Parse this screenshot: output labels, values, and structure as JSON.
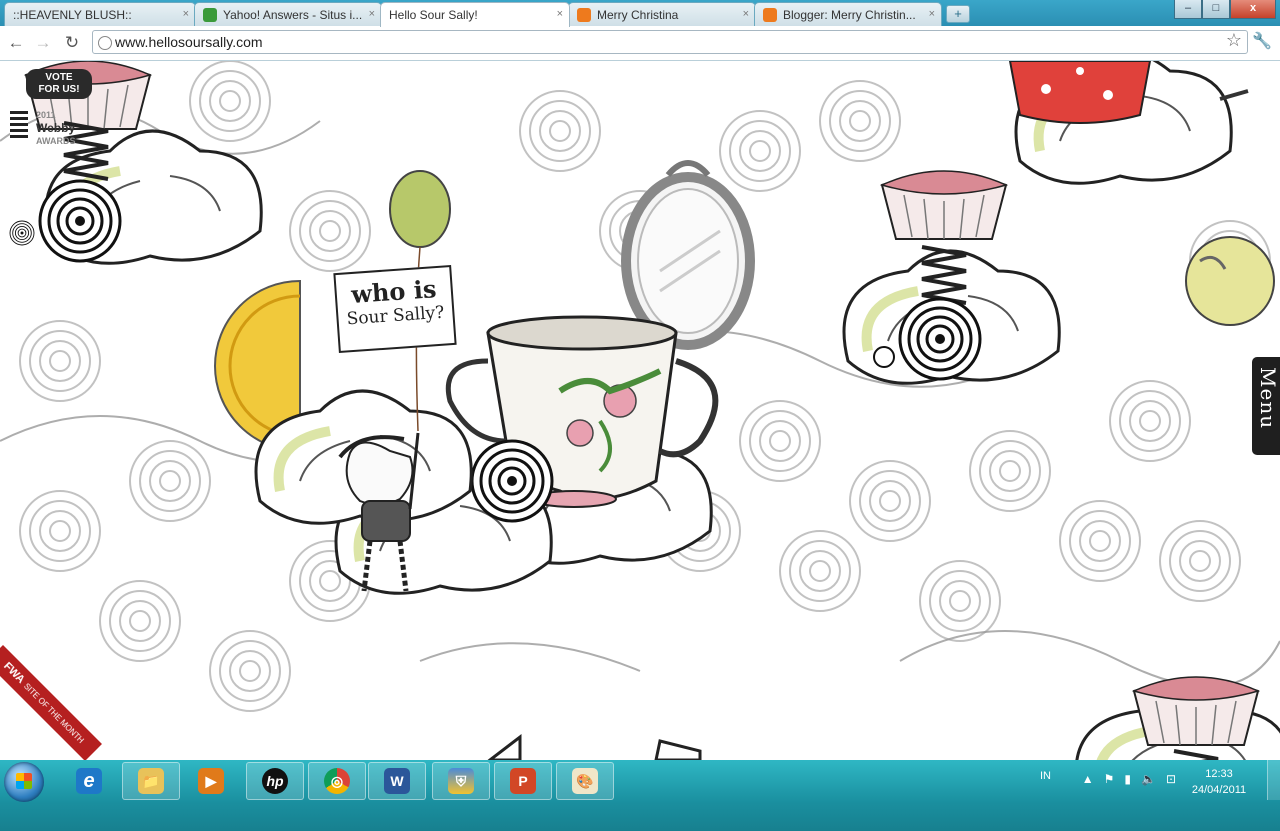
{
  "browser": {
    "tabs": [
      {
        "label": "::HEAVENLY BLUSH::",
        "favicon": "page-icon",
        "active": false
      },
      {
        "label": "Yahoo! Answers - Situs i...",
        "favicon": "yahoo-answers-icon",
        "active": false
      },
      {
        "label": "Hello Sour Sally!",
        "favicon": "page-icon",
        "active": true
      },
      {
        "label": "Merry Christina",
        "favicon": "blogger-icon",
        "active": false
      },
      {
        "label": "Blogger: Merry Christin...",
        "favicon": "blogger-icon",
        "active": false
      }
    ],
    "tab_close": "×",
    "new_tab": "+",
    "window_controls": {
      "minimize": "–",
      "maximize": "□",
      "close": "x"
    },
    "nav": {
      "back": "←",
      "forward": "→",
      "reload": "↻"
    },
    "url": "www.hellosoursally.com",
    "bookmark_star": "☆",
    "settings_wrench": "🔧"
  },
  "page": {
    "vote_badge": {
      "line1": "VOTE",
      "line2": "FOR US!"
    },
    "webby": {
      "line1": "2011",
      "line2": "Webby",
      "line3": "AWARDS"
    },
    "sign": {
      "line1": "who is",
      "line2": "Sour Sally?"
    },
    "menu_label": "Menu",
    "fwa": {
      "label": "FWA",
      "sub": "SITE OF THE MONTH"
    },
    "colors": {
      "accent_green": "#b7c86a",
      "cupcake_pink": "#d98a94",
      "sign_border": "#222222",
      "menu_bg": "#1f1f1f",
      "fwa_red": "#b52020"
    }
  },
  "taskbar": {
    "apps": [
      {
        "name": "internet-explorer",
        "glyph": "e"
      },
      {
        "name": "windows-explorer",
        "glyph": "📁"
      },
      {
        "name": "media-player",
        "glyph": "▶"
      },
      {
        "name": "hp",
        "glyph": "hp"
      },
      {
        "name": "chrome",
        "glyph": "◎"
      },
      {
        "name": "word",
        "glyph": "W"
      },
      {
        "name": "security-shield",
        "glyph": "⛨"
      },
      {
        "name": "powerpoint",
        "glyph": "P"
      },
      {
        "name": "paint",
        "glyph": "🎨"
      }
    ],
    "language": "IN",
    "time": "12:33",
    "date": "24/04/2011"
  }
}
